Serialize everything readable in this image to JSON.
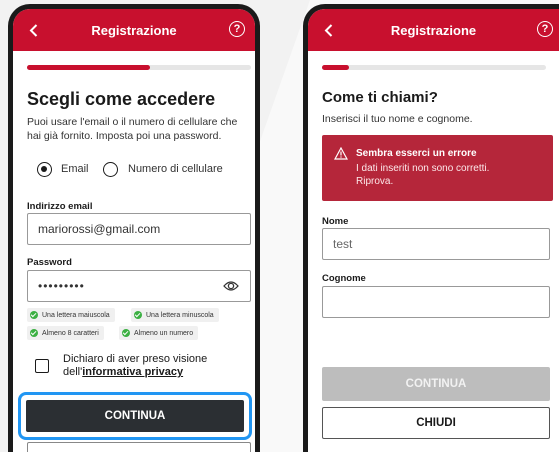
{
  "screen1": {
    "header_title": "Registrazione",
    "progress": 0.55,
    "heading": "Scegli come accedere",
    "desc_line1": "Puoi usare l'email o il numero di cellulare che",
    "desc_line2": "hai già fornito. Imposta poi una password.",
    "radio_email": "Email",
    "radio_phone": "Numero di cellulare",
    "email_label": "Indirizzo email",
    "email_value": "mariorossi@gmail.com",
    "password_label": "Password",
    "password_value": "•••••••••",
    "rules": [
      "Una lettera maiuscola",
      "Una lettera minuscola",
      "Almeno 8 caratteri",
      "Almeno un numero"
    ],
    "privacy_line1": "Dichiaro di aver preso visione",
    "privacy_prefix": "dell'",
    "privacy_link": "informativa privacy",
    "continue": "CONTINUA"
  },
  "screen2": {
    "header_title": "Registrazione",
    "progress": 0.12,
    "heading": "Come ti chiami?",
    "desc": "Inserisci il tuo nome e cognome.",
    "error_title": "Sembra esserci un errore",
    "error_line1": "I dati inseriti non sono corretti.",
    "error_line2": "Riprova.",
    "name_label": "Nome",
    "name_value": "test",
    "surname_label": "Cognome",
    "surname_value": "",
    "continue": "CONTINUA",
    "close": "CHIUDI"
  },
  "colors": {
    "brand_red": "#c8102e",
    "error_red": "#b5263a",
    "focus_blue": "#2196f3",
    "check_green": "#3cb043"
  }
}
